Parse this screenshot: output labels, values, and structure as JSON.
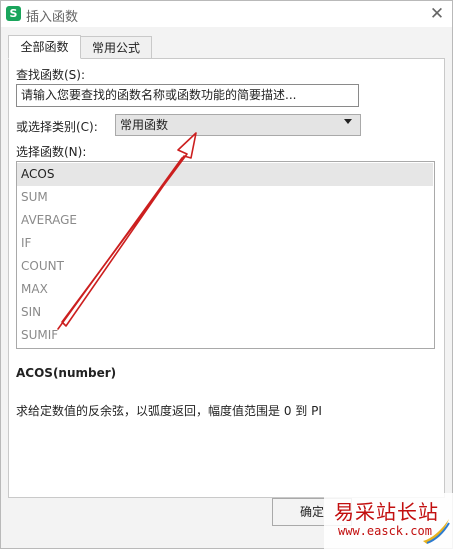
{
  "window": {
    "title": "插入函数",
    "app_icon_letter": "S",
    "close_glyph": "✕"
  },
  "tabs": [
    {
      "label": "全部函数",
      "active": true
    },
    {
      "label": "常用公式",
      "active": false
    }
  ],
  "search": {
    "label": "查找函数(S):",
    "value": "请输入您要查找的函数名称或函数功能的简要描述..."
  },
  "category": {
    "label": "或选择类别(C):",
    "selected": "常用函数"
  },
  "functions": {
    "label": "选择函数(N):",
    "items": [
      "ACOS",
      "SUM",
      "AVERAGE",
      "IF",
      "COUNT",
      "MAX",
      "SIN",
      "SUMIF"
    ],
    "selected_index": 0
  },
  "details": {
    "signature": "ACOS(number)",
    "description": "求给定数值的反余弦，以弧度返回，幅度值范围是 0 到 PI"
  },
  "buttons": {
    "ok": "确定"
  },
  "watermark": {
    "text": "易采站长站",
    "url": "www.easck.com"
  },
  "annotation": {
    "arrow_color": "#cc1f1f"
  },
  "colors": {
    "app_icon": "#1aa55c",
    "selection": "#e6e6e6",
    "watermark": "#c20f0f"
  }
}
